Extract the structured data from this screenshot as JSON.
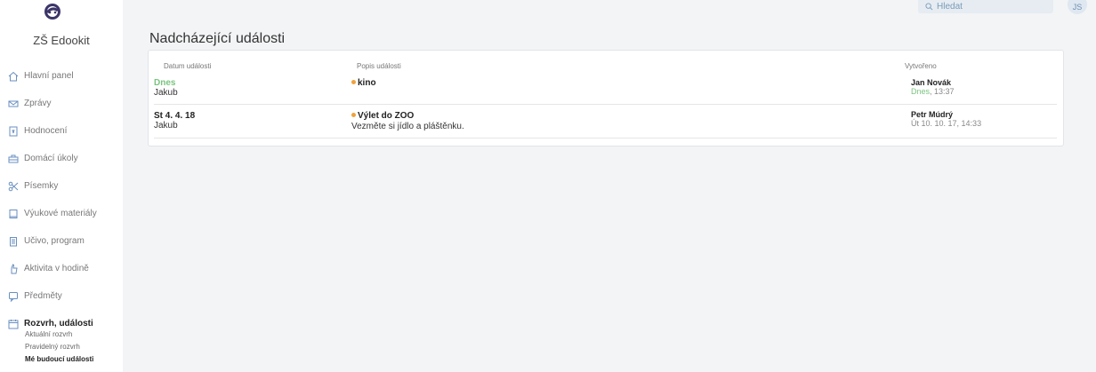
{
  "school": {
    "name": "ZŠ Edookit"
  },
  "header": {
    "search_placeholder": "Hledat",
    "user_initials": "JS"
  },
  "nav": [
    {
      "label": "Hlavní panel",
      "icon": "home-icon"
    },
    {
      "label": "Zprávy",
      "icon": "envelope-icon"
    },
    {
      "label": "Hodnocení",
      "icon": "grade-icon"
    },
    {
      "label": "Domácí úkoly",
      "icon": "briefcase-icon"
    },
    {
      "label": "Písemky",
      "icon": "scissors-icon"
    },
    {
      "label": "Výukové materiály",
      "icon": "book-icon"
    },
    {
      "label": "Učivo, program",
      "icon": "clipboard-icon"
    },
    {
      "label": "Aktivita v hodině",
      "icon": "hand-icon"
    },
    {
      "label": "Předměty",
      "icon": "chat-icon"
    },
    {
      "label": "Rozvrh, události",
      "icon": "calendar-icon"
    }
  ],
  "subnav": [
    {
      "label": "Aktuální rozvrh"
    },
    {
      "label": "Pravidelný rozvrh"
    },
    {
      "label": "Mé budoucí události"
    }
  ],
  "main": {
    "title": "Nadcházející události",
    "columns": {
      "date": "Datum události",
      "desc": "Popis události",
      "created": "Vytvořeno"
    },
    "rows": [
      {
        "date": "Dnes",
        "person": "Jakub",
        "title": "kino",
        "note": "",
        "creator": "Jan Novák",
        "created_day": "Dnes",
        "created_time": ", 13:37"
      },
      {
        "date": "St 4. 4. 18",
        "person": "Jakub",
        "title": "Výlet do ZOO",
        "note": "Vezměte si jídlo a pláštěnku.",
        "creator": "Petr Múdrý",
        "created_day": "Út 10. 10. 17",
        "created_time": ", 14:33"
      }
    ]
  },
  "colors": {
    "accent_green": "#7ac47f",
    "dot_orange": "#f0a23c"
  }
}
